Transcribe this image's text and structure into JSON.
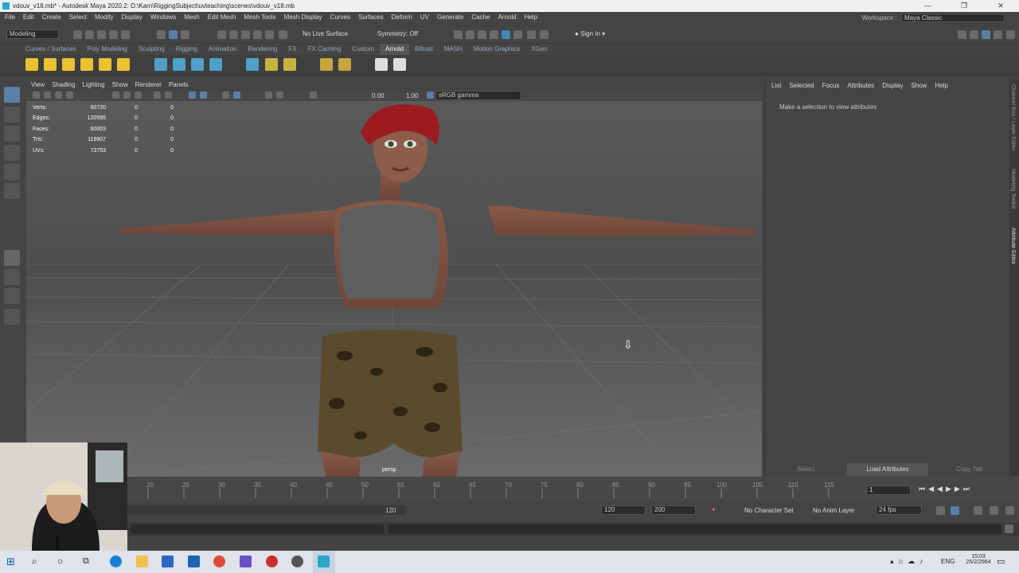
{
  "titlebar": {
    "title": "vdouv_v18.mb* - Autodesk Maya 2020.2: D:\\Karn\\RiggingSubject\\uvteaching\\scenes\\vdouv_v18.mb"
  },
  "menubar": {
    "items": [
      "File",
      "Edit",
      "Create",
      "Select",
      "Modify",
      "Display",
      "Windows",
      "Mesh",
      "Edit Mesh",
      "Mesh Tools",
      "Mesh Display",
      "Curves",
      "Surfaces",
      "Deform",
      "UV",
      "Generate",
      "Cache",
      "Arnold",
      "Help"
    ],
    "workspace_label": "Workspace :",
    "workspace_value": "Maya Classic"
  },
  "statusline": {
    "mode": "Modeling",
    "live_surface": "No Live Surface",
    "symmetry": "Symmetry: Off",
    "sign_in": "Sign In"
  },
  "shelf": {
    "tabs": [
      "Curves / Surfaces",
      "Poly Modeling",
      "Sculpting",
      "Rigging",
      "Animation",
      "Rendering",
      "FX",
      "FX Caching",
      "Custom",
      "Arnold",
      "Bifrost",
      "MASH",
      "Motion Graphics",
      "XGen"
    ],
    "active_tab": "Arnold"
  },
  "viewport": {
    "menu": [
      "View",
      "Shading",
      "Lighting",
      "Show",
      "Renderer",
      "Panels"
    ],
    "exposure": "0.00",
    "gamma": "1.00",
    "color_space": "sRGB gamma",
    "camera_label": "persp",
    "hud": [
      {
        "label": "Verts:",
        "v1": "60720",
        "v2": "0",
        "v3": "0"
      },
      {
        "label": "Edges:",
        "v1": "120595",
        "v2": "0",
        "v3": "0"
      },
      {
        "label": "Faces:",
        "v1": "60003",
        "v2": "0",
        "v3": "0"
      },
      {
        "label": "Tris:",
        "v1": "119907",
        "v2": "0",
        "v3": "0"
      },
      {
        "label": "UVs:",
        "v1": "73753",
        "v2": "0",
        "v3": "0"
      }
    ]
  },
  "attribute_editor": {
    "menu": [
      "List",
      "Selected",
      "Focus",
      "Attributes",
      "Display",
      "Show",
      "Help"
    ],
    "message": "Make a selection to view attributes",
    "buttons": [
      "Select",
      "Load Attributes",
      "Copy Tab"
    ]
  },
  "side_tabs": [
    "Channel Box / Layer Editor",
    "Modeling Toolkit",
    "Attribute Editor"
  ],
  "timeline": {
    "ticks": [
      "20",
      "25",
      "30",
      "35",
      "40",
      "45",
      "50",
      "55",
      "60",
      "65",
      "70",
      "75",
      "80",
      "85",
      "90",
      "95",
      "100",
      "105",
      "110",
      "115"
    ],
    "current_frame": "1"
  },
  "range": {
    "range_end_slider": "120",
    "end_frame": "120",
    "max_frame": "200",
    "character_set": "No Character Set",
    "anim_layer": "No Anim Layer",
    "fps": "24 fps"
  },
  "taskbar": {
    "lang": "ENG",
    "time": "15:03",
    "date": "25/2/2564"
  }
}
